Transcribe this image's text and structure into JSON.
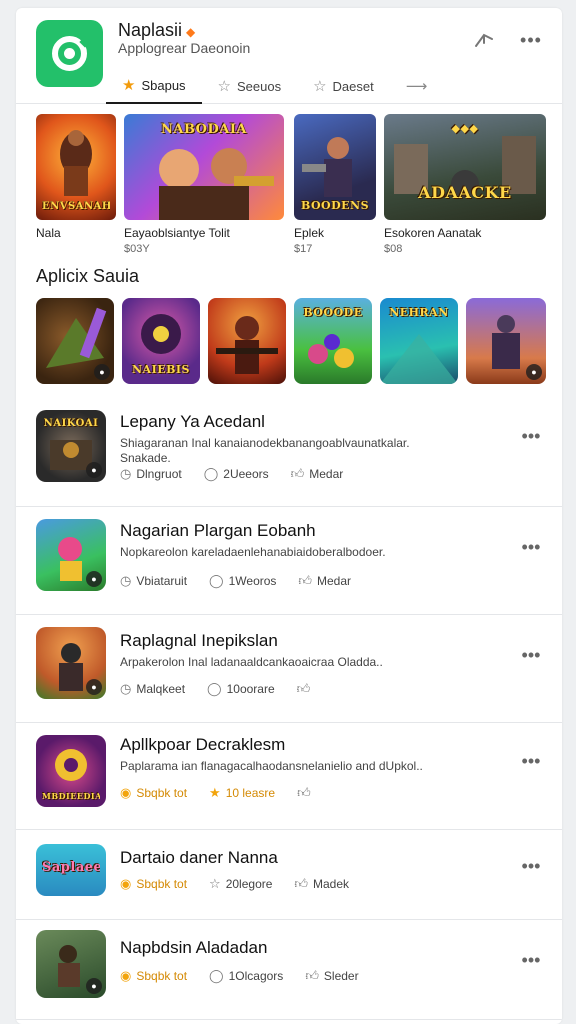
{
  "header": {
    "title": "Naplasii",
    "subtitle": "Applogrear Daeonoin",
    "flag_icon": "orange-badge-icon",
    "tabs": [
      {
        "label": "Sbapus",
        "icon": "star-icon",
        "active": true
      },
      {
        "label": "Seeuos",
        "icon": "star-outline-icon",
        "active": false
      },
      {
        "label": "Daeset",
        "icon": "star-outline-icon",
        "active": false
      },
      {
        "label": "",
        "icon": "arrow-icon",
        "active": false
      }
    ]
  },
  "featured": [
    {
      "art_text": "ENVSANAH AARAHAI",
      "name": "Nala",
      "price": ""
    },
    {
      "art_text": "NABODAIA",
      "name": "Eayaoblsiantye Tolit",
      "price": "$03Y"
    },
    {
      "art_text": "BOODENS",
      "name": "Eplek",
      "price": "$17"
    },
    {
      "art_text": "ADAACKE",
      "name": "Esokoren Aanatak",
      "price": "$08"
    }
  ],
  "section_title": "Aplicix Sauia",
  "thumbs": [
    {
      "art_text": "",
      "name": "game-thumb-1"
    },
    {
      "art_text": "NAIEBIS",
      "name": "game-thumb-2"
    },
    {
      "art_text": "",
      "name": "game-thumb-3"
    },
    {
      "art_text": "BOOODE",
      "name": "game-thumb-4"
    },
    {
      "art_text": "NEHRAN",
      "name": "game-thumb-5"
    },
    {
      "art_text": "",
      "name": "game-thumb-6"
    }
  ],
  "list": [
    {
      "icon_text": "NAIKOAI",
      "title": "Lepany Ya Acedanl",
      "desc": "Shiagaranan Inal kanaianodekbanangoablvaunatkalar. Snakade.",
      "meta": [
        {
          "icon": "clock-icon",
          "text": "Dlngruot",
          "gold": false
        },
        {
          "icon": "comment-icon",
          "text": "2Ueeors",
          "gold": false
        },
        {
          "icon": "thumbs-up-icon",
          "text": "Medar",
          "gold": false
        }
      ]
    },
    {
      "icon_text": "",
      "title": "Nagarian Plargan Eobanh",
      "desc": "Nopkareolon kareladaenlehanabiaidoberalbodoer.",
      "meta": [
        {
          "icon": "clock-icon",
          "text": "Vbiataruit",
          "gold": false
        },
        {
          "icon": "comment-icon",
          "text": "1Weoros",
          "gold": false
        },
        {
          "icon": "thumbs-up-icon",
          "text": "Medar",
          "gold": false
        }
      ]
    },
    {
      "icon_text": "",
      "title": "Raplagnal Inepikslan",
      "desc": "Arpakerolon Inal ladanaaldcankaoaicraa Oladda..",
      "meta": [
        {
          "icon": "clock-icon",
          "text": "Malqkeet",
          "gold": false
        },
        {
          "icon": "comment-icon",
          "text": "10oorare",
          "gold": false
        },
        {
          "icon": "thumbs-up-icon",
          "text": "",
          "gold": false
        }
      ]
    },
    {
      "icon_text": "MBDIEEDIA",
      "title": "Apllkpoar Decraklesm",
      "desc": "Paplarama ian flanagacalhaodansnelanielio and dUpkol..",
      "meta": [
        {
          "icon": "gold-badge-icon",
          "text": "Sbqbk tot",
          "gold": true
        },
        {
          "icon": "star-icon",
          "text": "10 leasre",
          "gold": true
        },
        {
          "icon": "thumbs-up-icon",
          "text": "",
          "gold": false
        }
      ]
    },
    {
      "icon_text": "Saplaee",
      "title": "Dartaio daner Nanna",
      "desc": "",
      "meta": [
        {
          "icon": "gold-badge-icon",
          "text": "Sbqbk tot",
          "gold": true
        },
        {
          "icon": "star-outline-icon",
          "text": "20legore",
          "gold": false
        },
        {
          "icon": "thumbs-up-icon",
          "text": "Madek",
          "gold": false
        }
      ]
    },
    {
      "icon_text": "",
      "title": "Napbdsin Aladadan",
      "desc": "",
      "meta": [
        {
          "icon": "gold-badge-icon",
          "text": "Sbqbk tot",
          "gold": true
        },
        {
          "icon": "comment-icon",
          "text": "1Olcagors",
          "gold": false
        },
        {
          "icon": "thumbs-up-icon",
          "text": "Sleder",
          "gold": false
        }
      ]
    }
  ],
  "colors": {
    "accent_green": "#23c06a",
    "accent_gold": "#f2a40c",
    "divider": "#e4e6e9"
  }
}
